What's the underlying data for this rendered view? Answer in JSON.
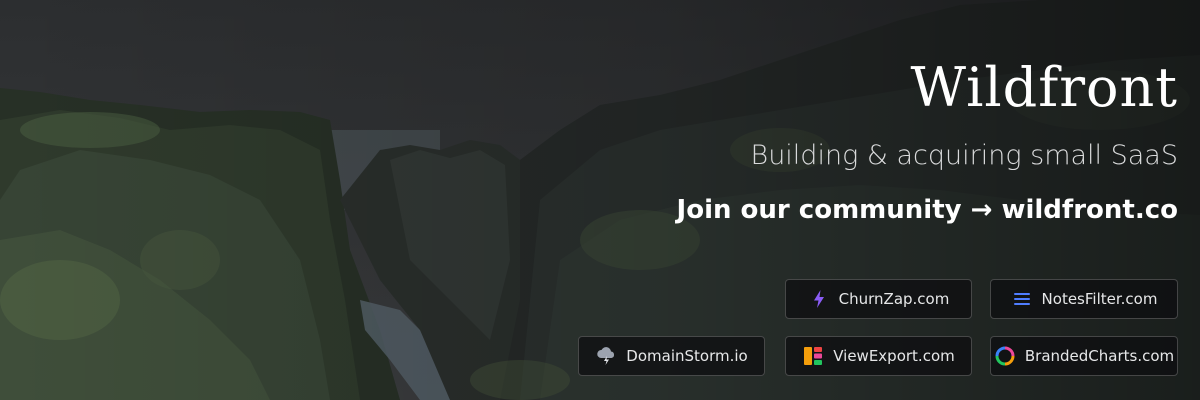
{
  "brand": {
    "title": "Wildfront",
    "subtitle": "Building & acquiring small SaaS",
    "cta": "Join our community → wildfront.co"
  },
  "products": [
    {
      "label": "ChurnZap.com",
      "icon": "lightning-icon",
      "accent": "#8b5cf6"
    },
    {
      "label": "NotesFilter.com",
      "icon": "filter-lines-icon",
      "accent": "#4f7dff"
    },
    {
      "label": "DomainStorm.io",
      "icon": "storm-cloud-icon",
      "accent": "#9ca3af"
    },
    {
      "label": "ViewExport.com",
      "icon": "export-grid-icon",
      "accent": "#f59e0b"
    },
    {
      "label": "BrandedCharts.com",
      "icon": "color-ring-icon",
      "accent": "#ec4899"
    }
  ],
  "colors": {
    "background": "#1e2022",
    "text": "#ffffff",
    "chip_background": "#0c0d0f"
  }
}
